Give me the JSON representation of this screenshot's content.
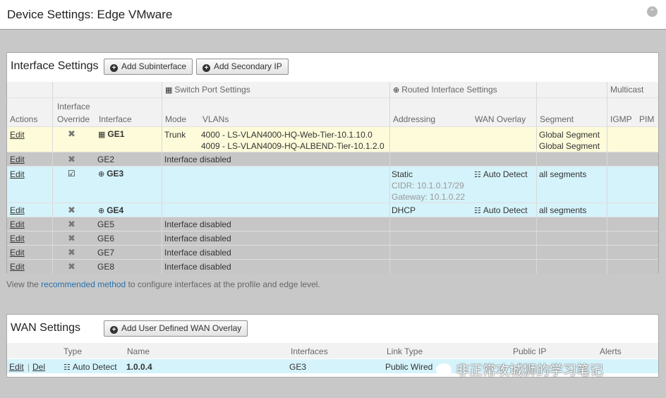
{
  "window": {
    "title": "Device Settings: Edge VMware"
  },
  "interface_settings": {
    "title": "Interface Settings",
    "add_subinterface": "Add Subinterface",
    "add_secondary_ip": "Add Secondary IP",
    "group_headers": {
      "switch_port": "Switch Port Settings",
      "routed": "Routed Interface Settings",
      "multicast": "Multicast"
    },
    "columns": {
      "actions": "Actions",
      "override_1": "Interface",
      "override_2": "Override",
      "interface": "Interface",
      "mode": "Mode",
      "vlans": "VLANs",
      "addressing": "Addressing",
      "wan_overlay": "WAN Overlay",
      "segment": "Segment",
      "igmp": "IGMP",
      "pim": "PIM"
    },
    "rows": [
      {
        "edit": "Edit",
        "interface": "GE1",
        "mode": "Trunk",
        "vlan1": "4000 - LS-VLAN4000-HQ-Web-Tier-10.1.10.0",
        "vlan2": "4009 - LS-VLAN4009-HQ-ALBEND-Tier-10.1.2.0",
        "segment1": "Global Segment",
        "segment2": "Global Segment"
      },
      {
        "edit": "Edit",
        "interface": "GE2",
        "status": "Interface disabled"
      },
      {
        "edit": "Edit",
        "interface": "GE3",
        "addressing": "Static",
        "cidr": "CIDR: 10.1.0.17/29",
        "gateway": "Gateway: 10.1.0.22",
        "wan_overlay": "Auto Detect",
        "segment": "all segments"
      },
      {
        "edit": "Edit",
        "interface": "GE4",
        "addressing": "DHCP",
        "wan_overlay": "Auto Detect",
        "segment": "all segments"
      },
      {
        "edit": "Edit",
        "interface": "GE5",
        "status": "Interface disabled"
      },
      {
        "edit": "Edit",
        "interface": "GE6",
        "status": "Interface disabled"
      },
      {
        "edit": "Edit",
        "interface": "GE7",
        "status": "Interface disabled"
      },
      {
        "edit": "Edit",
        "interface": "GE8",
        "status": "Interface disabled"
      }
    ],
    "note_prefix": "View the",
    "note_link": "recommended method",
    "note_suffix": "to configure interfaces at the profile and edge level."
  },
  "wan_settings": {
    "title": "WAN Settings",
    "add_overlay": "Add User Defined WAN Overlay",
    "columns": {
      "type": "Type",
      "name": "Name",
      "interfaces": "Interfaces",
      "link_type": "Link Type",
      "public_ip": "Public IP",
      "alerts": "Alerts"
    },
    "row": {
      "edit": "Edit",
      "sep": "|",
      "del": "Del",
      "type": "Auto Detect",
      "name": "1.0.0.4",
      "interfaces": "GE3",
      "link_type": "Public Wired"
    }
  },
  "watermark": "非正常攻城狮的学习笔记"
}
